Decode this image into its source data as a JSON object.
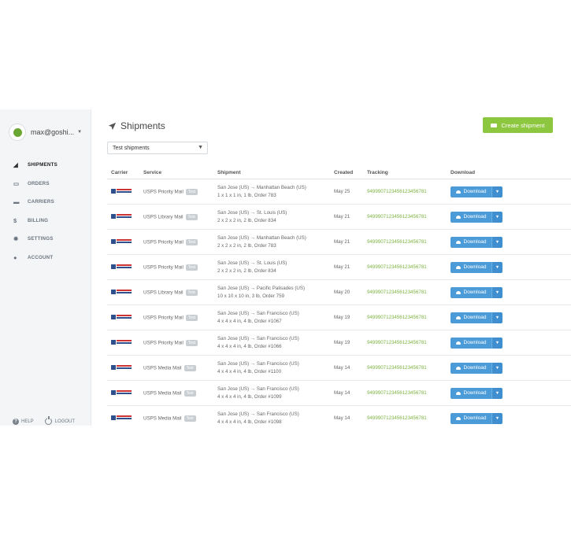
{
  "sidebar": {
    "user": "max@goshi...",
    "nav": [
      {
        "label": "SHIPMENTS",
        "icon": "paper-plane-icon",
        "active": true
      },
      {
        "label": "ORDERS",
        "icon": "inbox-icon",
        "active": false
      },
      {
        "label": "CARRIERS",
        "icon": "truck-icon",
        "active": false
      },
      {
        "label": "BILLING",
        "icon": "dollar-icon",
        "active": false
      },
      {
        "label": "SETTINGS",
        "icon": "gear-icon",
        "active": false
      },
      {
        "label": "ACCOUNT",
        "icon": "user-icon",
        "active": false
      }
    ],
    "help": "HELP",
    "logout": "LOGOUT"
  },
  "main": {
    "title": "Shipments",
    "create_button": "Create shipment",
    "filter": "Test shipments"
  },
  "table": {
    "headers": [
      "Carrier",
      "Service",
      "Shipment",
      "Created",
      "Tracking",
      "Download"
    ],
    "badge": "Test",
    "download_label": "Download",
    "rows": [
      {
        "service": "USPS Priority Mail",
        "route": "San Jose (US) → Manhattan Beach (US)",
        "details": "1 x 1 x 1 in, 1 lb, Order 783",
        "created": "May 25",
        "tracking": "9499907123456123456781"
      },
      {
        "service": "USPS Library Mail",
        "route": "San Jose (US) → St. Louis (US)",
        "details": "2 x 2 x 2 in, 2 lb, Order 834",
        "created": "May 21",
        "tracking": "9499907123456123456781"
      },
      {
        "service": "USPS Priority Mail",
        "route": "San Jose (US) → Manhattan Beach (US)",
        "details": "2 x 2 x 2 in, 2 lb, Order 783",
        "created": "May 21",
        "tracking": "9499907123456123456781"
      },
      {
        "service": "USPS Priority Mail",
        "route": "San Jose (US) → St. Louis (US)",
        "details": "2 x 2 x 2 in, 2 lb, Order 834",
        "created": "May 21",
        "tracking": "9499907123456123456781"
      },
      {
        "service": "USPS Library Mail",
        "route": "San Jose (US) → Pacific Palisades (US)",
        "details": "10 x 10 x 10 in, 3 lb, Order 759",
        "created": "May 20",
        "tracking": "9499907123456123456781"
      },
      {
        "service": "USPS Priority Mail",
        "route": "San Jose (US) → San Francisco (US)",
        "details": "4 x 4 x 4 in, 4 lb, Order #1067",
        "created": "May 19",
        "tracking": "9499907123456123456781"
      },
      {
        "service": "USPS Priority Mail",
        "route": "San Jose (US) → San Francisco (US)",
        "details": "4 x 4 x 4 in, 4 lb, Order #1066",
        "created": "May 19",
        "tracking": "9499907123456123456781"
      },
      {
        "service": "USPS Media Mail",
        "route": "San Jose (US) → San Francisco (US)",
        "details": "4 x 4 x 4 in, 4 lb, Order #1100",
        "created": "May 14",
        "tracking": "9499907123456123456781"
      },
      {
        "service": "USPS Media Mail",
        "route": "San Jose (US) → San Francisco (US)",
        "details": "4 x 4 x 4 in, 4 lb, Order #1099",
        "created": "May 14",
        "tracking": "9499907123456123456781"
      },
      {
        "service": "USPS Media Mail",
        "route": "San Jose (US) → San Francisco (US)",
        "details": "4 x 4 x 4 in, 4 lb, Order #1098",
        "created": "May 14",
        "tracking": "9499907123456123456781"
      }
    ]
  },
  "colors": {
    "accent_green": "#8dc63f",
    "download_blue": "#4a9bd8",
    "tracking_green": "#7cb342",
    "sidebar_bg": "#f3f5f7"
  }
}
